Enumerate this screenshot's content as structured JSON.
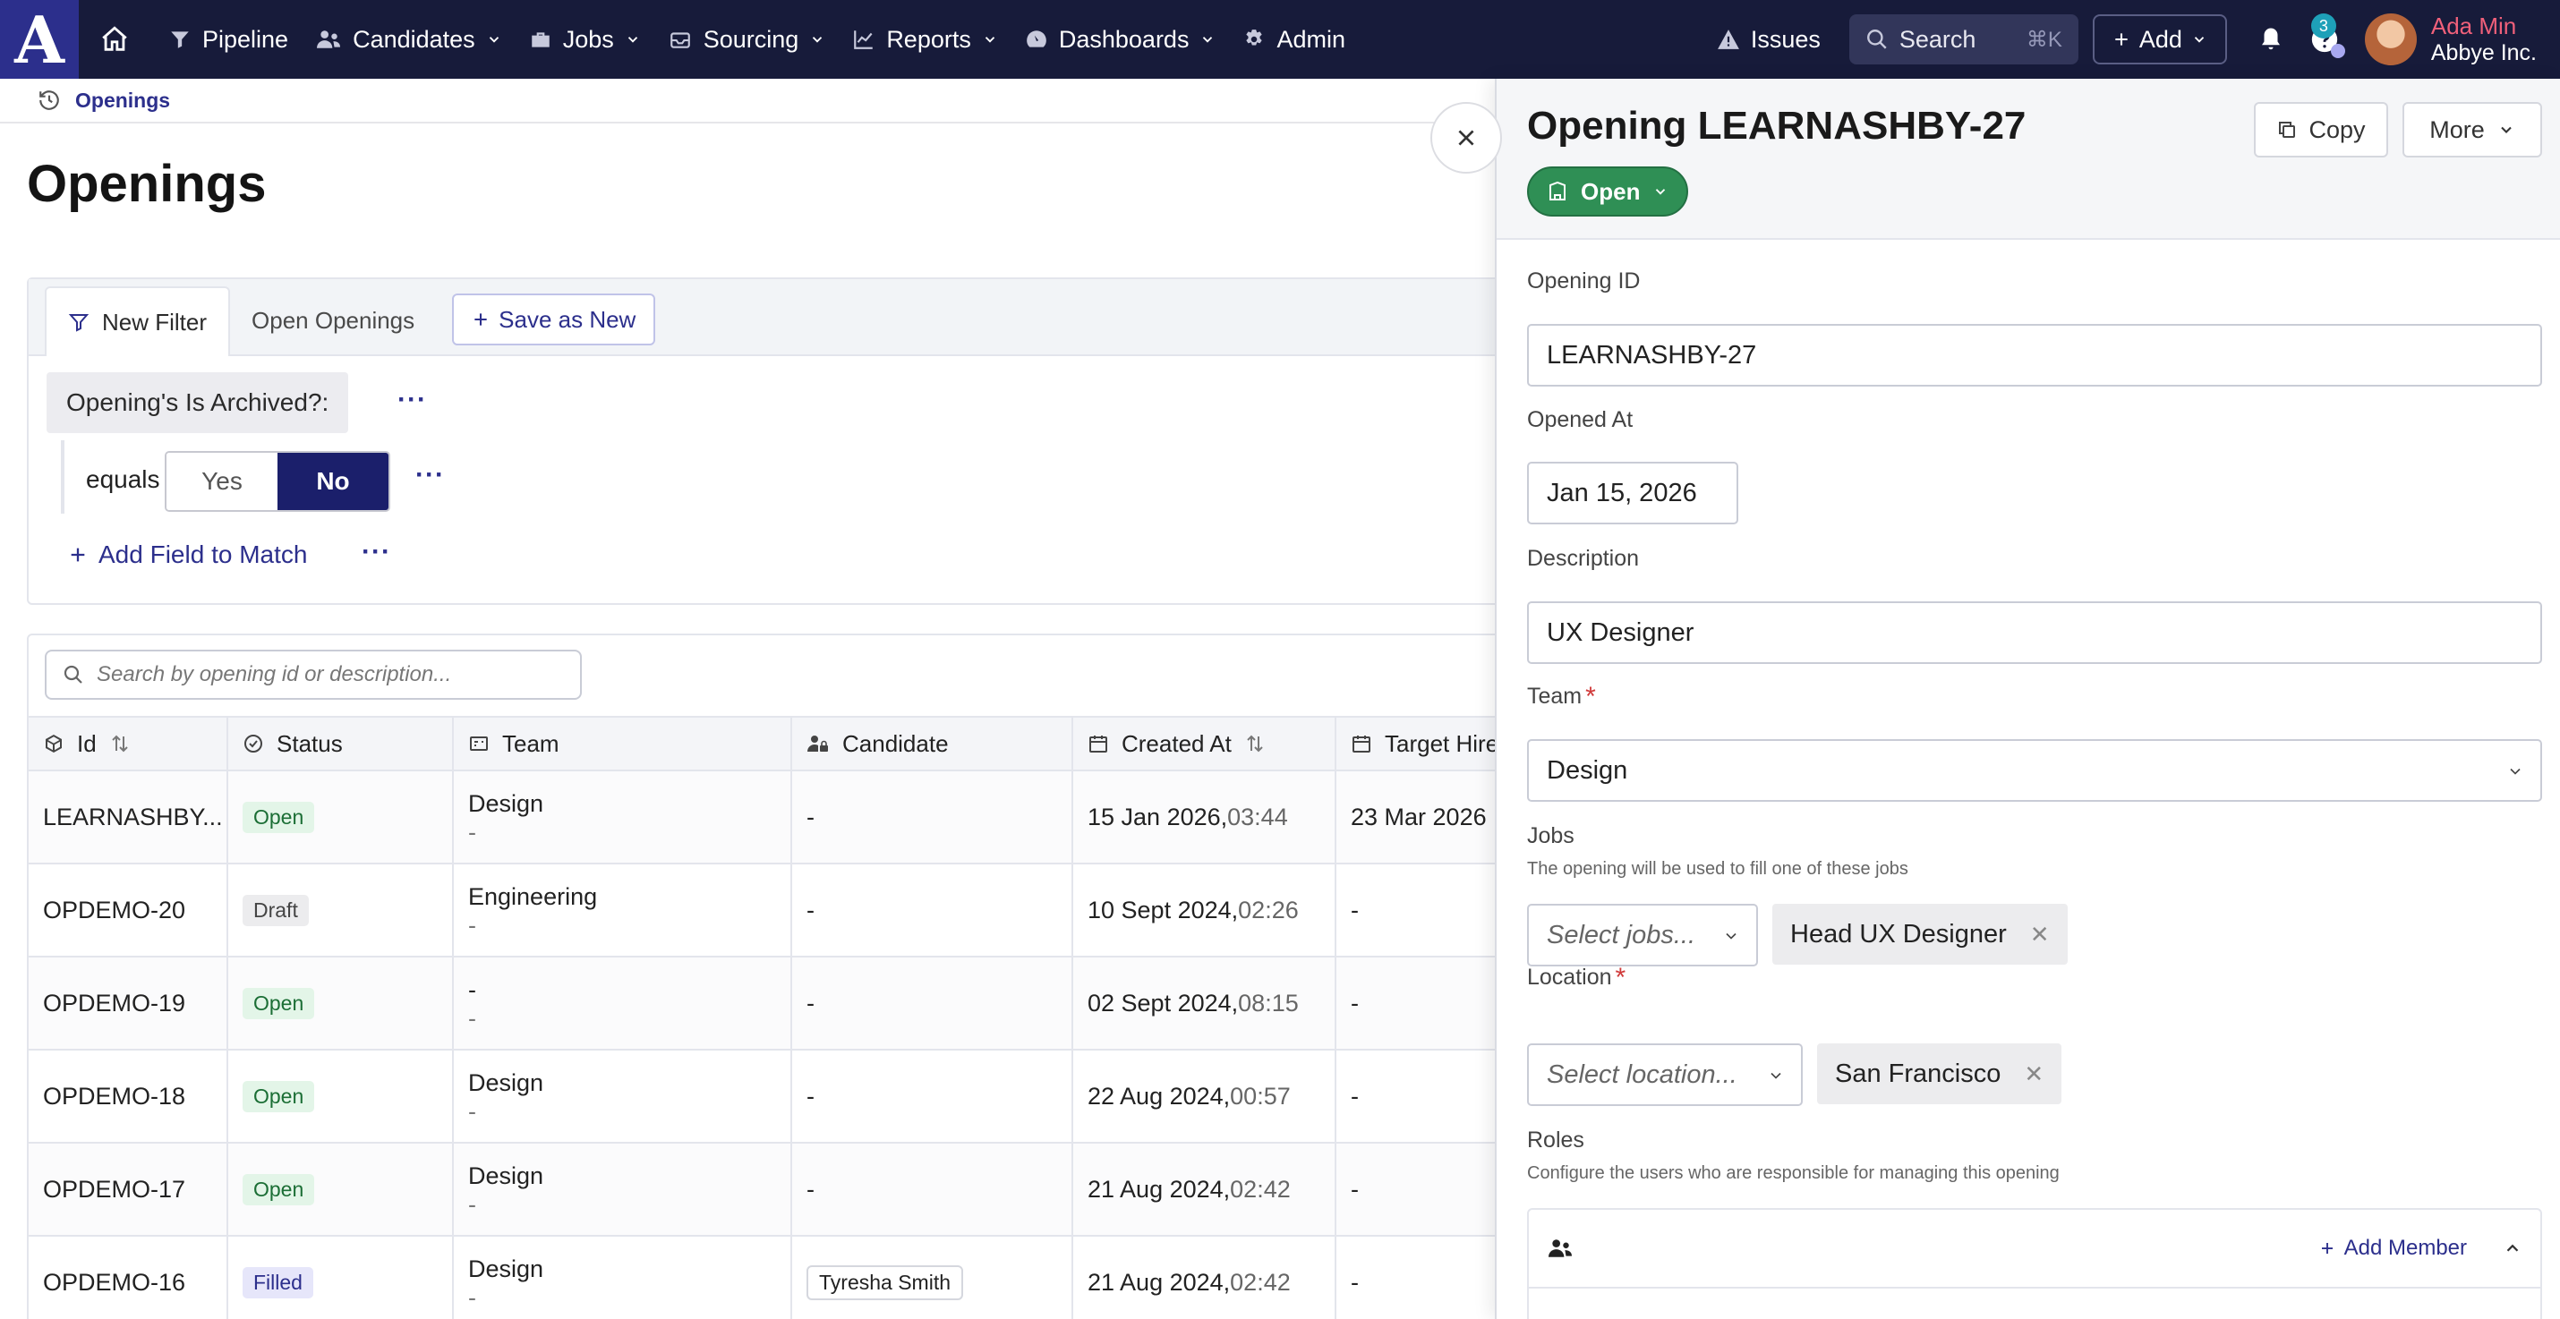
{
  "nav": {
    "logo": "A",
    "items": [
      {
        "label": "Pipeline",
        "dropdown": false
      },
      {
        "label": "Candidates",
        "dropdown": true
      },
      {
        "label": "Jobs",
        "dropdown": true
      },
      {
        "label": "Sourcing",
        "dropdown": true
      },
      {
        "label": "Reports",
        "dropdown": true
      },
      {
        "label": "Dashboards",
        "dropdown": true
      },
      {
        "label": "Admin",
        "dropdown": false
      }
    ],
    "issues": "Issues",
    "search_label": "Search",
    "search_shortcut": "⌘K",
    "add_label": "Add",
    "help_badge": "3",
    "user_name": "Ada Min",
    "user_org": "Abbye Inc."
  },
  "breadcrumb": {
    "label": "Openings"
  },
  "page": {
    "title": "Openings"
  },
  "filter": {
    "tabs": {
      "new_filter": "New Filter",
      "open_openings": "Open Openings",
      "save_as_new": "Save as New"
    },
    "condition_label": "Opening's Is Archived?:",
    "operator": "equals",
    "yes": "Yes",
    "no": "No",
    "selected": "No",
    "add_field": "Add Field to Match",
    "more": "···"
  },
  "table": {
    "search_placeholder": "Search by opening id or description...",
    "columns": [
      "Id",
      "Status",
      "Team",
      "Candidate",
      "Created At",
      "Target Hire"
    ],
    "rows": [
      {
        "id": "LEARNASHBY...",
        "status": "Open",
        "team": "Design",
        "team_sub": "-",
        "candidate": "-",
        "created_date": "15 Jan 2026,",
        "created_time": "03:44",
        "target": "23 Mar 2026"
      },
      {
        "id": "OPDEMO-20",
        "status": "Draft",
        "team": "Engineering",
        "team_sub": "-",
        "candidate": "-",
        "created_date": "10 Sept 2024,",
        "created_time": "02:26",
        "target": "-"
      },
      {
        "id": "OPDEMO-19",
        "status": "Open",
        "team": "-",
        "team_sub": "-",
        "candidate": "-",
        "created_date": "02 Sept 2024,",
        "created_time": "08:15",
        "target": "-"
      },
      {
        "id": "OPDEMO-18",
        "status": "Open",
        "team": "Design",
        "team_sub": "-",
        "candidate": "-",
        "created_date": "22 Aug 2024,",
        "created_time": "00:57",
        "target": "-"
      },
      {
        "id": "OPDEMO-17",
        "status": "Open",
        "team": "Design",
        "team_sub": "-",
        "candidate": "-",
        "created_date": "21 Aug 2024,",
        "created_time": "02:42",
        "target": "-"
      },
      {
        "id": "OPDEMO-16",
        "status": "Filled",
        "team": "Design",
        "team_sub": "-",
        "candidate": "Tyresha Smith",
        "created_date": "21 Aug 2024,",
        "created_time": "02:42",
        "target": "-"
      }
    ]
  },
  "panel": {
    "title": "Opening LEARNASHBY-27",
    "status": "Open",
    "copy": "Copy",
    "more": "More",
    "opening_id_label": "Opening ID",
    "opening_id_value": "LEARNASHBY-27",
    "opened_at_label": "Opened At",
    "opened_at_value": "Jan 15, 2026",
    "description_label": "Description",
    "description_value": "UX Designer",
    "team_label": "Team",
    "team_value": "Design",
    "jobs_label": "Jobs",
    "jobs_help": "The opening will be used to fill one of these jobs",
    "jobs_placeholder": "Select jobs...",
    "jobs_selected": "Head UX Designer",
    "location_label": "Location",
    "location_placeholder": "Select location...",
    "location_selected": "San Francisco",
    "roles_label": "Roles",
    "roles_help": "Configure the users who are responsible for managing this opening",
    "add_member": "Add Member",
    "required_mark": "*"
  },
  "colors": {
    "nav_bg": "#171b3a",
    "brand": "#2c2f8c",
    "open_green": "#2f8f55",
    "required_red": "#d03a3a"
  }
}
